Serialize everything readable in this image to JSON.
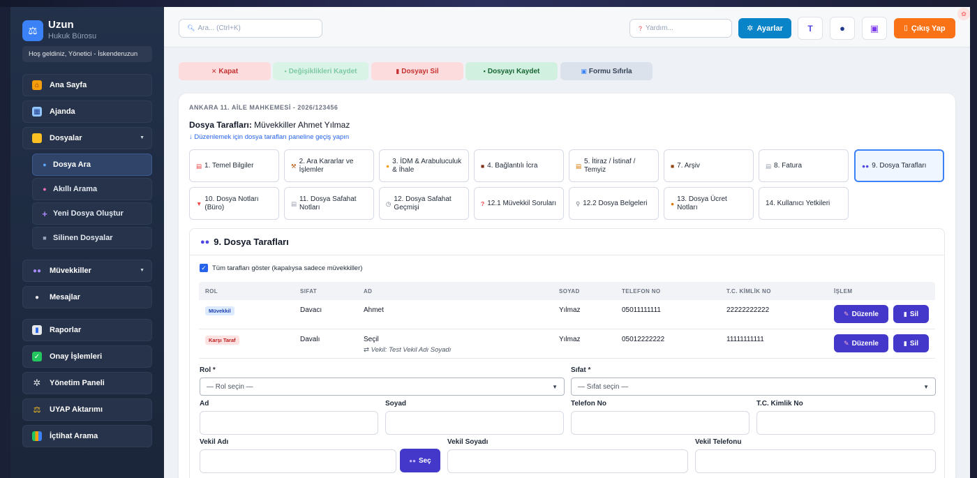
{
  "brand": {
    "name": "Uzun",
    "subtitle": "Hukuk Bürosu",
    "logo_icon": "scales-icon"
  },
  "welcome": "Hoş geldiniz, Yönetici - İskenderuzun",
  "nav": {
    "home": "Ana Sayfa",
    "agenda": "Ajanda",
    "files": "Dosyalar",
    "files_sub": {
      "search": "Dosya Ara",
      "smart_search": "Akıllı Arama",
      "new_file": "Yeni Dosya Oluştur",
      "deleted": "Silinen Dosyalar"
    },
    "clients": "Müvekkiller",
    "messages": "Mesajlar",
    "reports": "Raporlar",
    "approvals": "Onay İşlemleri",
    "admin": "Yönetim Paneli",
    "uyap": "UYAP Aktarımı",
    "case_law": "İçtihat Arama"
  },
  "topbar": {
    "search_placeholder": "Ara... (Ctrl+K)",
    "help_placeholder": "Yardım...",
    "settings": "Ayarlar",
    "logout": "Çıkış Yap"
  },
  "actions": {
    "close": "Kapat",
    "save_changes": "Değişiklikleri Kaydet",
    "delete_file": "Dosyayı Sil",
    "save_file": "Dosyayı Kaydet",
    "reset_form": "Formu Sıfırla"
  },
  "file": {
    "court": "ANKARA 11. AİLE MAHKEMESİ - 2026/123456",
    "parties_label": "Dosya Tarafları:",
    "parties_value": "Müvekkiller Ahmet Yılmaz",
    "hint": "↓ Düzenlemek için dosya tarafları paneline geçiş yapın"
  },
  "tabs": [
    "1. Temel Bilgiler",
    "2. Ara Kararlar ve İşlemler",
    "3. İDM & Arabuluculuk & İhale",
    "4. Bağlantılı İcra",
    "5. İtiraz / İstinaf / Temyiz",
    "7. Arşiv",
    "8. Fatura",
    "9. Dosya Tarafları",
    "10. Dosya Notları (Büro)",
    "11. Dosya Safahat Notları",
    "12. Dosya Safahat Geçmişi",
    "12.1 Müvekkil Soruları",
    "12.2 Dosya Belgeleri",
    "13. Dosya Ücret Notları",
    "14. Kullanıcı Yetkileri"
  ],
  "section": {
    "title": "9. Dosya Tarafları",
    "show_all": "Tüm tarafları göster (kapalıysa sadece müvekkiller)",
    "columns": [
      "ROL",
      "SIFAT",
      "AD",
      "SOYAD",
      "TELEFON NO",
      "T.C. KİMLİK NO",
      "İŞLEM"
    ],
    "rows": [
      {
        "role": "Müvekkil",
        "sifat": "Davacı",
        "ad": "Ahmet",
        "vekil": "",
        "soyad": "Yılmaz",
        "telefon": "05011111111",
        "tc": "22222222222"
      },
      {
        "role": "Karşı Taraf",
        "sifat": "Davalı",
        "ad": "Seçil",
        "vekil": "⇄ Vekil: Test Vekil Adı Soyadı",
        "soyad": "Yılmaz",
        "telefon": "05012222222",
        "tc": "11111111111"
      }
    ],
    "edit": "Düzenle",
    "delete": "Sil"
  },
  "form": {
    "rol_label": "Rol *",
    "rol_placeholder": "— Rol seçin —",
    "sifat_label": "Sıfat *",
    "sifat_placeholder": "— Sıfat seçin —",
    "ad": "Ad",
    "soyad": "Soyad",
    "telefon": "Telefon No",
    "tc": "T.C. Kimlik No",
    "vekil_adi": "Vekil Adı",
    "sec": "Seç",
    "vekil_soyadi": "Vekil Soyadı",
    "vekil_telefonu": "Vekil Telefonu"
  },
  "colors": {
    "accent": "#4338ca",
    "settings": "#0a84c8",
    "logout": "#f97316",
    "sidebar": "#223049"
  }
}
